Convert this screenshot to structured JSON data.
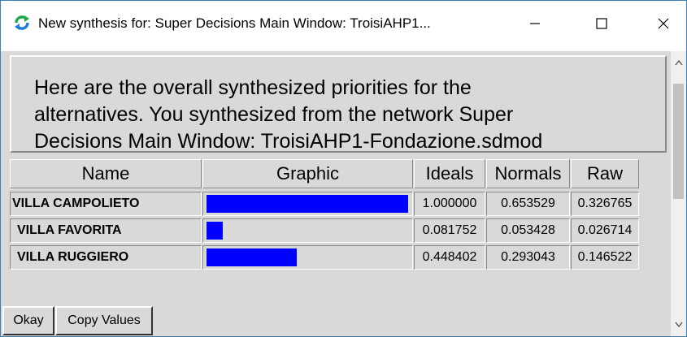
{
  "window": {
    "title": "New synthesis for: Super Decisions Main Window: TroisiAHP1...",
    "controls": {
      "minimize": "minimize-icon",
      "maximize": "maximize-icon",
      "close": "close-icon"
    }
  },
  "message": {
    "line1": "Here are the overall synthesized priorities for the",
    "line2": "alternatives.  You synthesized from the network Super",
    "line3": "Decisions Main Window: TroisiAHP1-Fondazione.sdmod"
  },
  "table": {
    "headers": {
      "name": "Name",
      "graphic": "Graphic",
      "ideals": "Ideals",
      "normals": "Normals",
      "raw": "Raw"
    },
    "rows": [
      {
        "name": "VILLA CAMPOLIETO",
        "ideals": "1.000000",
        "normals": "0.653529",
        "raw": "0.326765",
        "bar_fraction": 1.0
      },
      {
        "name": "VILLA FAVORITA",
        "ideals": "0.081752",
        "normals": "0.053428",
        "raw": "0.026714",
        "bar_fraction": 0.081752
      },
      {
        "name": "VILLA RUGGIERO",
        "ideals": "0.448402",
        "normals": "0.293043",
        "raw": "0.146522",
        "bar_fraction": 0.448402
      }
    ],
    "bar_color": "#0000ff"
  },
  "buttons": {
    "okay": "Okay",
    "copy_values": "Copy Values"
  },
  "colors": {
    "accent_icon": "#1fa84a",
    "background": "#d9d9d9"
  }
}
